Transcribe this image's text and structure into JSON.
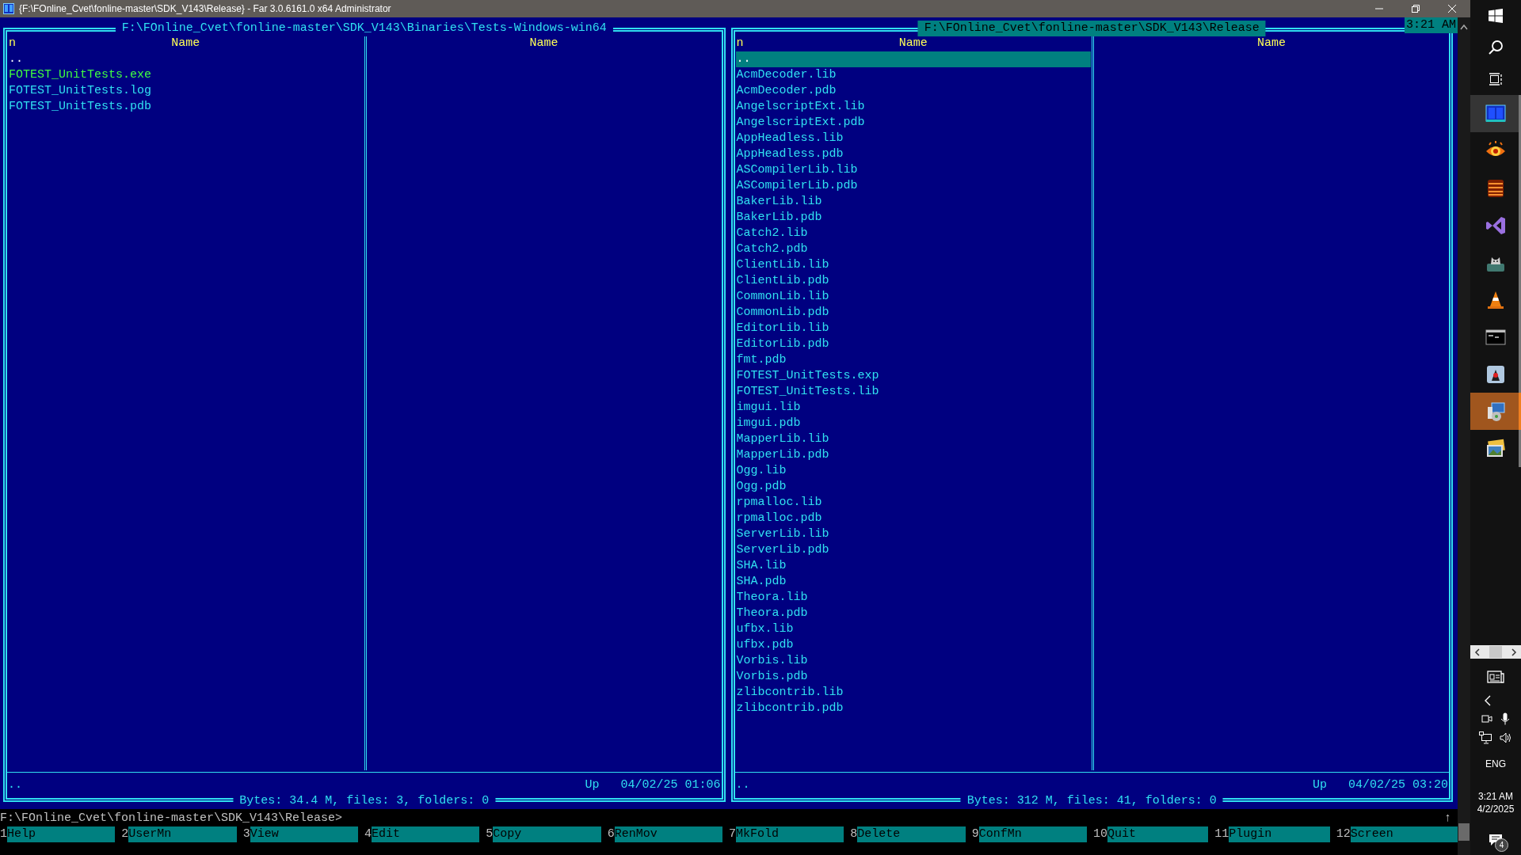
{
  "window": {
    "title": "{F:\\FOnline_Cvet\\fonline-master\\SDK_V143\\Release} - Far 3.0.6161.0 x64 Administrator"
  },
  "clock": "3:21 AM",
  "panels": [
    {
      "path": "F:\\FOnline_Cvet\\fonline-master\\SDK_V143\\Binaries\\Tests-Windows-win64",
      "active": false,
      "sort_mark": "n",
      "columns": [
        "Name",
        "Name"
      ],
      "files": [
        {
          "name": "..",
          "kind": "up",
          "selected": false
        },
        {
          "name": "FOTEST_UnitTests.exe",
          "kind": "executable",
          "selected": false
        },
        {
          "name": "FOTEST_UnitTests.log",
          "kind": "file",
          "selected": false
        },
        {
          "name": "FOTEST_UnitTests.pdb",
          "kind": "file",
          "selected": false
        }
      ],
      "status": {
        "name": "..",
        "label": "Up",
        "date": "04/02/25 01:06"
      },
      "summary": "Bytes: 34.4 M, files: 3, folders: 0"
    },
    {
      "path": "F:\\FOnline_Cvet\\fonline-master\\SDK_V143\\Release",
      "active": true,
      "sort_mark": "n",
      "columns": [
        "Name",
        "Name"
      ],
      "files": [
        {
          "name": "..",
          "kind": "up",
          "selected": true
        },
        {
          "name": "AcmDecoder.lib",
          "kind": "file",
          "selected": false
        },
        {
          "name": "AcmDecoder.pdb",
          "kind": "file",
          "selected": false
        },
        {
          "name": "AngelscriptExt.lib",
          "kind": "file",
          "selected": false
        },
        {
          "name": "AngelscriptExt.pdb",
          "kind": "file",
          "selected": false
        },
        {
          "name": "AppHeadless.lib",
          "kind": "file",
          "selected": false
        },
        {
          "name": "AppHeadless.pdb",
          "kind": "file",
          "selected": false
        },
        {
          "name": "ASCompilerLib.lib",
          "kind": "file",
          "selected": false
        },
        {
          "name": "ASCompilerLib.pdb",
          "kind": "file",
          "selected": false
        },
        {
          "name": "BakerLib.lib",
          "kind": "file",
          "selected": false
        },
        {
          "name": "BakerLib.pdb",
          "kind": "file",
          "selected": false
        },
        {
          "name": "Catch2.lib",
          "kind": "file",
          "selected": false
        },
        {
          "name": "Catch2.pdb",
          "kind": "file",
          "selected": false
        },
        {
          "name": "ClientLib.lib",
          "kind": "file",
          "selected": false
        },
        {
          "name": "ClientLib.pdb",
          "kind": "file",
          "selected": false
        },
        {
          "name": "CommonLib.lib",
          "kind": "file",
          "selected": false
        },
        {
          "name": "CommonLib.pdb",
          "kind": "file",
          "selected": false
        },
        {
          "name": "EditorLib.lib",
          "kind": "file",
          "selected": false
        },
        {
          "name": "EditorLib.pdb",
          "kind": "file",
          "selected": false
        },
        {
          "name": "fmt.pdb",
          "kind": "file",
          "selected": false
        },
        {
          "name": "FOTEST_UnitTests.exp",
          "kind": "file",
          "selected": false
        },
        {
          "name": "FOTEST_UnitTests.lib",
          "kind": "file",
          "selected": false
        },
        {
          "name": "imgui.lib",
          "kind": "file",
          "selected": false
        },
        {
          "name": "imgui.pdb",
          "kind": "file",
          "selected": false
        },
        {
          "name": "MapperLib.lib",
          "kind": "file",
          "selected": false
        },
        {
          "name": "MapperLib.pdb",
          "kind": "file",
          "selected": false
        },
        {
          "name": "Ogg.lib",
          "kind": "file",
          "selected": false
        },
        {
          "name": "Ogg.pdb",
          "kind": "file",
          "selected": false
        },
        {
          "name": "rpmalloc.lib",
          "kind": "file",
          "selected": false
        },
        {
          "name": "rpmalloc.pdb",
          "kind": "file",
          "selected": false
        },
        {
          "name": "ServerLib.lib",
          "kind": "file",
          "selected": false
        },
        {
          "name": "ServerLib.pdb",
          "kind": "file",
          "selected": false
        },
        {
          "name": "SHA.lib",
          "kind": "file",
          "selected": false
        },
        {
          "name": "SHA.pdb",
          "kind": "file",
          "selected": false
        },
        {
          "name": "Theora.lib",
          "kind": "file",
          "selected": false
        },
        {
          "name": "Theora.pdb",
          "kind": "file",
          "selected": false
        },
        {
          "name": "ufbx.lib",
          "kind": "file",
          "selected": false
        },
        {
          "name": "ufbx.pdb",
          "kind": "file",
          "selected": false
        },
        {
          "name": "Vorbis.lib",
          "kind": "file",
          "selected": false
        },
        {
          "name": "Vorbis.pdb",
          "kind": "file",
          "selected": false
        },
        {
          "name": "zlibcontrib.lib",
          "kind": "file",
          "selected": false
        },
        {
          "name": "zlibcontrib.pdb",
          "kind": "file",
          "selected": false
        }
      ],
      "status": {
        "name": "..",
        "label": "Up",
        "date": "04/02/25 03:20"
      },
      "summary": "Bytes: 312 M, files: 41, folders: 0"
    }
  ],
  "command_line": {
    "prompt": "F:\\FOnline_Cvet\\fonline-master\\SDK_V143\\Release>",
    "indicator": "↑"
  },
  "keybar": [
    {
      "key": "1",
      "label": "Help"
    },
    {
      "key": "2",
      "label": "UserMn"
    },
    {
      "key": "3",
      "label": "View"
    },
    {
      "key": "4",
      "label": "Edit"
    },
    {
      "key": "5",
      "label": "Copy"
    },
    {
      "key": "6",
      "label": "RenMov"
    },
    {
      "key": "7",
      "label": "MkFold"
    },
    {
      "key": "8",
      "label": "Delete"
    },
    {
      "key": "9",
      "label": "ConfMn"
    },
    {
      "key": "10",
      "label": "Quit"
    },
    {
      "key": "11",
      "label": "Plugin"
    },
    {
      "key": "12",
      "label": "Screen"
    }
  ],
  "taskbar": {
    "apps": [
      {
        "kind": "panels",
        "active": true,
        "attention": false
      },
      {
        "kind": "eye",
        "active": false,
        "attention": false
      },
      {
        "kind": "coil",
        "active": false,
        "attention": false
      },
      {
        "kind": "ribbon",
        "active": false,
        "attention": false
      },
      {
        "kind": "cat",
        "active": false,
        "attention": false
      },
      {
        "kind": "cone",
        "active": false,
        "attention": false
      },
      {
        "kind": "terminal",
        "active": false,
        "attention": false
      },
      {
        "kind": "mascot",
        "active": false,
        "attention": false
      },
      {
        "kind": "installer",
        "active": false,
        "attention": true
      },
      {
        "kind": "photos",
        "active": false,
        "attention": false
      }
    ],
    "language": "ENG",
    "time": "3:21 AM",
    "date": "4/2/2025",
    "notification_count": "4"
  }
}
